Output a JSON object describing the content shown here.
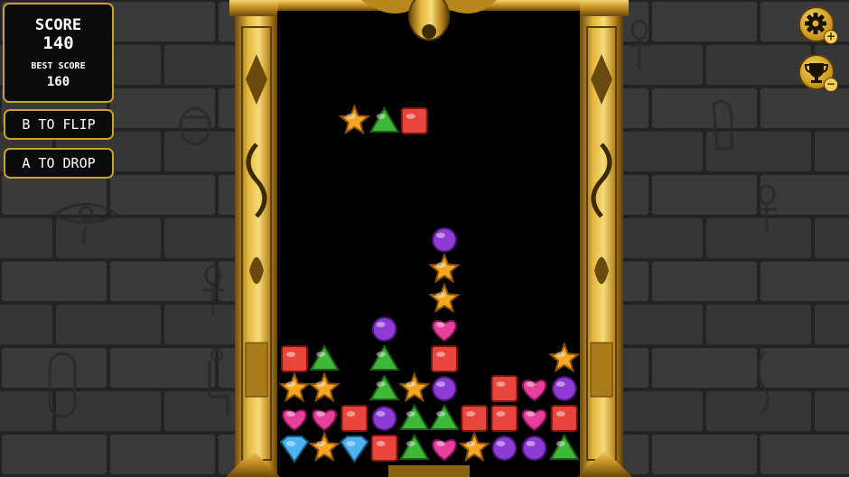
{
  "hud": {
    "score_label": "SCORE",
    "score_value": "140",
    "best_label": "BEST SCORE",
    "best_value": "160"
  },
  "controls": {
    "flip_label": "B TO FLIP",
    "drop_label": "A TO DROP"
  },
  "buttons": {
    "settings_icon": "gear-plus-icon",
    "leaderboard_icon": "trophy-minus-icon",
    "settings_badge": "+",
    "leaderboard_badge": "−"
  },
  "colors": {
    "gold": "#c9a227",
    "board_bg": "#000000",
    "wall": "#2b2b2b"
  },
  "board": {
    "columns": 9,
    "falling_piece": [
      {
        "col": 2,
        "row": 3,
        "gem": "star"
      },
      {
        "col": 3,
        "row": 3,
        "gem": "triangle"
      },
      {
        "col": 4,
        "row": 3,
        "gem": "square"
      }
    ],
    "gems": [
      {
        "col": 5,
        "row": 7,
        "gem": "circle"
      },
      {
        "col": 5,
        "row": 8,
        "gem": "star"
      },
      {
        "col": 5,
        "row": 9,
        "gem": "star"
      },
      {
        "col": 3,
        "row": 10,
        "gem": "circle"
      },
      {
        "col": 5,
        "row": 10,
        "gem": "heart"
      },
      {
        "col": 0,
        "row": 11,
        "gem": "square"
      },
      {
        "col": 1,
        "row": 11,
        "gem": "triangle"
      },
      {
        "col": 3,
        "row": 11,
        "gem": "triangle"
      },
      {
        "col": 5,
        "row": 11,
        "gem": "square"
      },
      {
        "col": 9,
        "row": 11,
        "gem": "star"
      },
      {
        "col": 0,
        "row": 12,
        "gem": "star"
      },
      {
        "col": 1,
        "row": 12,
        "gem": "star"
      },
      {
        "col": 3,
        "row": 12,
        "gem": "triangle"
      },
      {
        "col": 4,
        "row": 12,
        "gem": "star"
      },
      {
        "col": 5,
        "row": 12,
        "gem": "circle"
      },
      {
        "col": 7,
        "row": 12,
        "gem": "square"
      },
      {
        "col": 8,
        "row": 12,
        "gem": "heart"
      },
      {
        "col": 9,
        "row": 12,
        "gem": "circle"
      },
      {
        "col": 0,
        "row": 13,
        "gem": "heart"
      },
      {
        "col": 1,
        "row": 13,
        "gem": "heart"
      },
      {
        "col": 2,
        "row": 13,
        "gem": "square"
      },
      {
        "col": 3,
        "row": 13,
        "gem": "circle"
      },
      {
        "col": 4,
        "row": 13,
        "gem": "triangle"
      },
      {
        "col": 5,
        "row": 13,
        "gem": "triangle"
      },
      {
        "col": 6,
        "row": 13,
        "gem": "square"
      },
      {
        "col": 7,
        "row": 13,
        "gem": "square"
      },
      {
        "col": 8,
        "row": 13,
        "gem": "heart"
      },
      {
        "col": 9,
        "row": 13,
        "gem": "square"
      },
      {
        "col": 0,
        "row": 14,
        "gem": "diamond"
      },
      {
        "col": 1,
        "row": 14,
        "gem": "star"
      },
      {
        "col": 2,
        "row": 14,
        "gem": "diamond"
      },
      {
        "col": 3,
        "row": 14,
        "gem": "square"
      },
      {
        "col": 4,
        "row": 14,
        "gem": "triangle"
      },
      {
        "col": 5,
        "row": 14,
        "gem": "heart"
      },
      {
        "col": 6,
        "row": 14,
        "gem": "star"
      },
      {
        "col": 7,
        "row": 14,
        "gem": "circle"
      },
      {
        "col": 8,
        "row": 14,
        "gem": "circle"
      },
      {
        "col": 9,
        "row": 14,
        "gem": "triangle"
      }
    ]
  }
}
